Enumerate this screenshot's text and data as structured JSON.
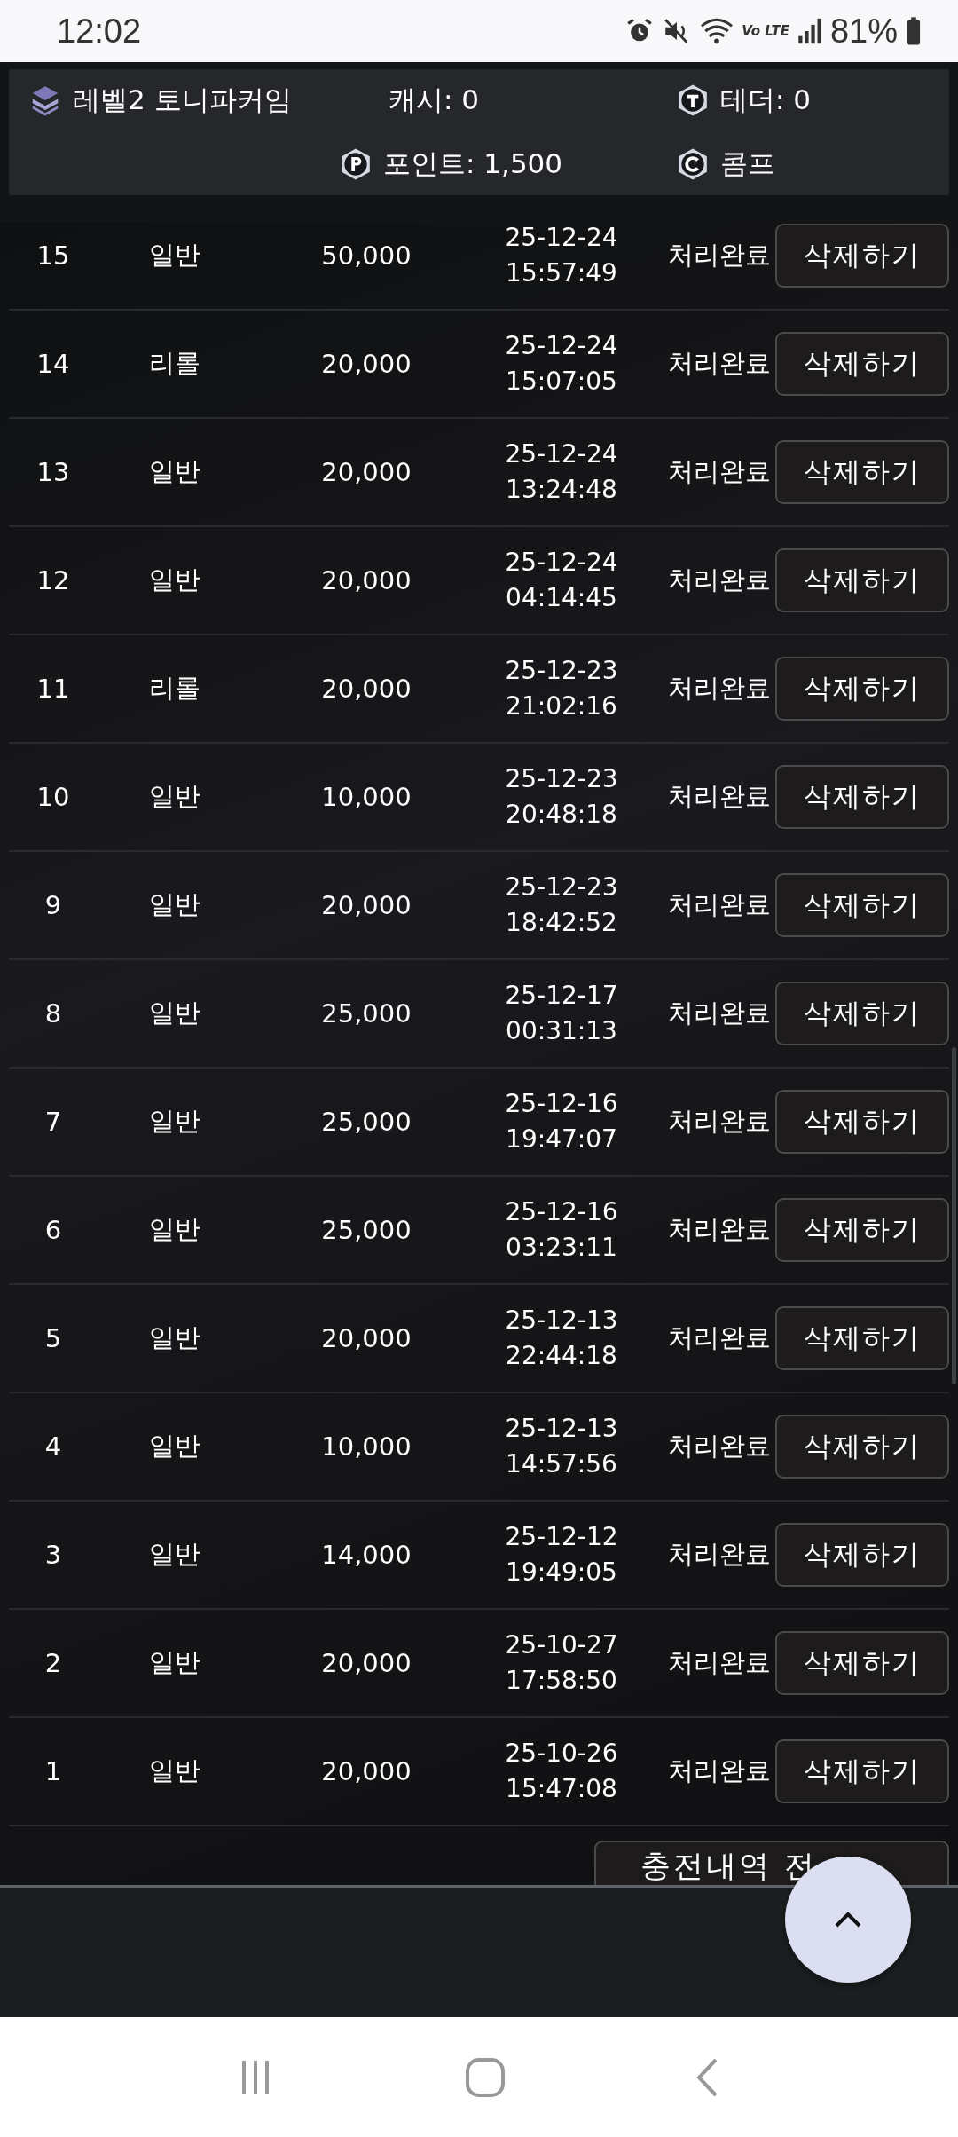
{
  "status_bar": {
    "time": "12:02",
    "network": "Vo LTE",
    "battery": "81%"
  },
  "header": {
    "level": "레벨2 토니파커임",
    "cash": "캐시: 0",
    "tether": "테더: 0",
    "points": "포인트: 1,500",
    "comp": "콤프"
  },
  "rows": [
    {
      "no": "15",
      "type": "일반",
      "amount": "50,000",
      "date": "25-12-24",
      "time": "15:57:49",
      "status": "처리완료",
      "action": "삭제하기"
    },
    {
      "no": "14",
      "type": "리롤",
      "amount": "20,000",
      "date": "25-12-24",
      "time": "15:07:05",
      "status": "처리완료",
      "action": "삭제하기"
    },
    {
      "no": "13",
      "type": "일반",
      "amount": "20,000",
      "date": "25-12-24",
      "time": "13:24:48",
      "status": "처리완료",
      "action": "삭제하기"
    },
    {
      "no": "12",
      "type": "일반",
      "amount": "20,000",
      "date": "25-12-24",
      "time": "04:14:45",
      "status": "처리완료",
      "action": "삭제하기"
    },
    {
      "no": "11",
      "type": "리롤",
      "amount": "20,000",
      "date": "25-12-23",
      "time": "21:02:16",
      "status": "처리완료",
      "action": "삭제하기"
    },
    {
      "no": "10",
      "type": "일반",
      "amount": "10,000",
      "date": "25-12-23",
      "time": "20:48:18",
      "status": "처리완료",
      "action": "삭제하기"
    },
    {
      "no": "9",
      "type": "일반",
      "amount": "20,000",
      "date": "25-12-23",
      "time": "18:42:52",
      "status": "처리완료",
      "action": "삭제하기"
    },
    {
      "no": "8",
      "type": "일반",
      "amount": "25,000",
      "date": "25-12-17",
      "time": "00:31:13",
      "status": "처리완료",
      "action": "삭제하기"
    },
    {
      "no": "7",
      "type": "일반",
      "amount": "25,000",
      "date": "25-12-16",
      "time": "19:47:07",
      "status": "처리완료",
      "action": "삭제하기"
    },
    {
      "no": "6",
      "type": "일반",
      "amount": "25,000",
      "date": "25-12-16",
      "time": "03:23:11",
      "status": "처리완료",
      "action": "삭제하기"
    },
    {
      "no": "5",
      "type": "일반",
      "amount": "20,000",
      "date": "25-12-13",
      "time": "22:44:18",
      "status": "처리완료",
      "action": "삭제하기"
    },
    {
      "no": "4",
      "type": "일반",
      "amount": "10,000",
      "date": "25-12-13",
      "time": "14:57:56",
      "status": "처리완료",
      "action": "삭제하기"
    },
    {
      "no": "3",
      "type": "일반",
      "amount": "14,000",
      "date": "25-12-12",
      "time": "19:49:05",
      "status": "처리완료",
      "action": "삭제하기"
    },
    {
      "no": "2",
      "type": "일반",
      "amount": "20,000",
      "date": "25-10-27",
      "time": "17:58:50",
      "status": "처리완료",
      "action": "삭제하기"
    },
    {
      "no": "1",
      "type": "일반",
      "amount": "20,000",
      "date": "25-10-26",
      "time": "15:47:08",
      "status": "처리완료",
      "action": "삭제하기"
    }
  ],
  "delete_all_button": "충전내역 전"
}
